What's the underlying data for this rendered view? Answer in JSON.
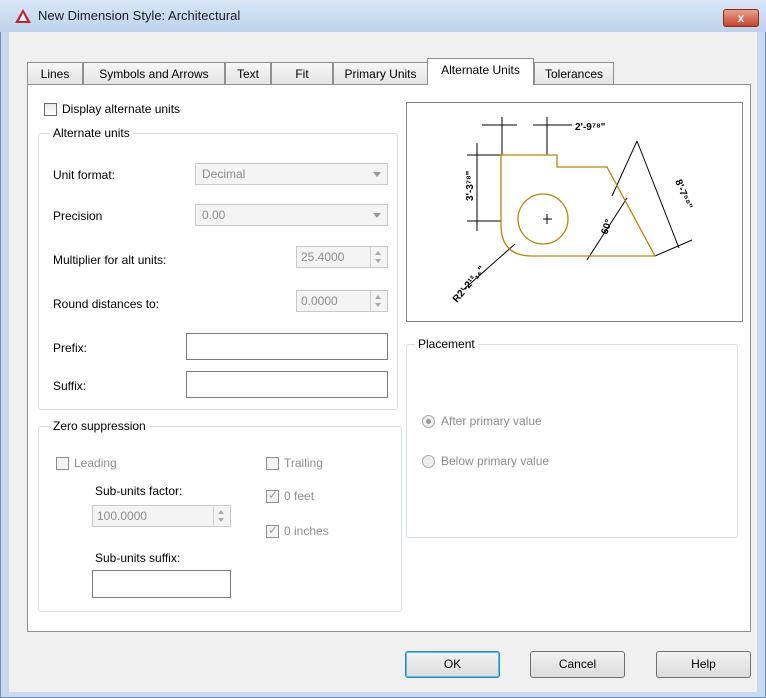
{
  "window": {
    "title": "New Dimension Style: Architectural",
    "close_label": "x"
  },
  "tabs": [
    {
      "label": "Lines"
    },
    {
      "label": "Symbols and Arrows"
    },
    {
      "label": "Text"
    },
    {
      "label": "Fit"
    },
    {
      "label": "Primary Units"
    },
    {
      "label": "Alternate Units",
      "active": true
    },
    {
      "label": "Tolerances"
    }
  ],
  "display_alternate_units": {
    "label": "Display alternate units",
    "checked": false
  },
  "alternate_units": {
    "legend": "Alternate units",
    "unit_format_label": "Unit format:",
    "unit_format_value": "Decimal",
    "precision_label": "Precision",
    "precision_value": "0.00",
    "multiplier_label": "Multiplier for alt units:",
    "multiplier_value": "25.4000",
    "round_label": "Round distances  to:",
    "round_value": "0.0000",
    "prefix_label": "Prefix:",
    "prefix_value": "",
    "suffix_label": "Suffix:",
    "suffix_value": ""
  },
  "zero_suppression": {
    "legend": "Zero suppression",
    "leading_label": "Leading",
    "trailing_label": "Trailing",
    "sub_units_factor_label": "Sub-units factor:",
    "sub_units_factor_value": "100.0000",
    "zero_feet_label": "0 feet",
    "zero_inches_label": "0 inches",
    "sub_units_suffix_label": "Sub-units suffix:",
    "sub_units_suffix_value": ""
  },
  "preview": {
    "dims": [
      "2'-9⁷⁸\"",
      "3'-3⁷⁸\"",
      "8'-7⁵⁸\"",
      "60°",
      "R2'-2¹³₁₆\""
    ]
  },
  "placement": {
    "legend": "Placement",
    "after_label": "After primary value",
    "below_label": "Below primary value"
  },
  "buttons": {
    "ok": "OK",
    "cancel": "Cancel",
    "help": "Help"
  },
  "colors": {
    "accent": "#3c7fb1",
    "preview_outline": "#b8860b"
  }
}
